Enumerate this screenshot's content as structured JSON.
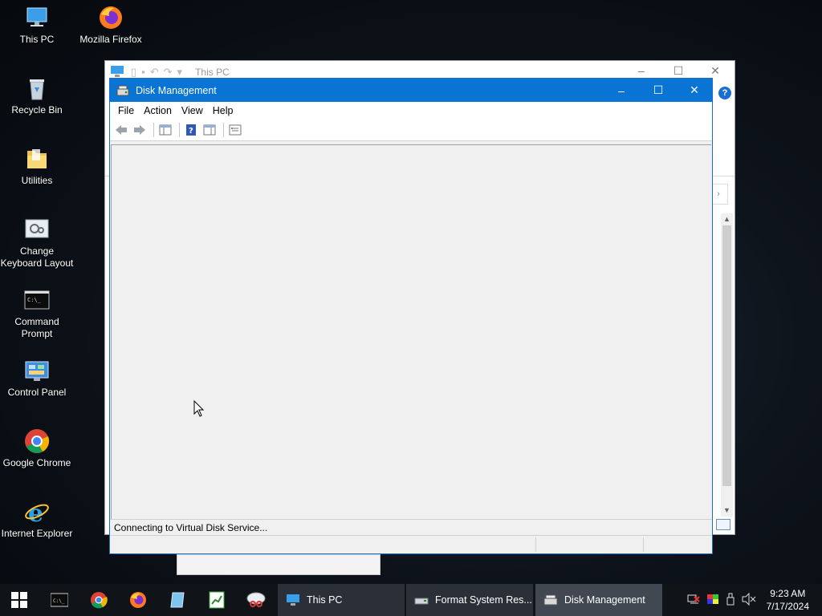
{
  "desktop": {
    "icons": [
      {
        "label": "This PC"
      },
      {
        "label": "Mozilla Firefox"
      },
      {
        "label": "Recycle Bin"
      },
      {
        "label": "Utilities"
      },
      {
        "label": "Change Keyboard Layout"
      },
      {
        "label": "Command Prompt"
      },
      {
        "label": "Control Panel"
      },
      {
        "label": "Google Chrome"
      },
      {
        "label": "Internet Explorer"
      }
    ]
  },
  "explorer": {
    "title": "This PC"
  },
  "disk_management": {
    "title": "Disk Management",
    "menu": [
      "File",
      "Action",
      "View",
      "Help"
    ],
    "status": "Connecting to Virtual Disk Service..."
  },
  "taskbar": {
    "windows": [
      {
        "label": "This PC"
      },
      {
        "label": "Format System Res..."
      },
      {
        "label": "Disk Management"
      }
    ],
    "time": "9:23 AM",
    "date": "7/17/2024"
  },
  "colors": {
    "accent": "#0a74d4",
    "taskbar": "#101318"
  }
}
